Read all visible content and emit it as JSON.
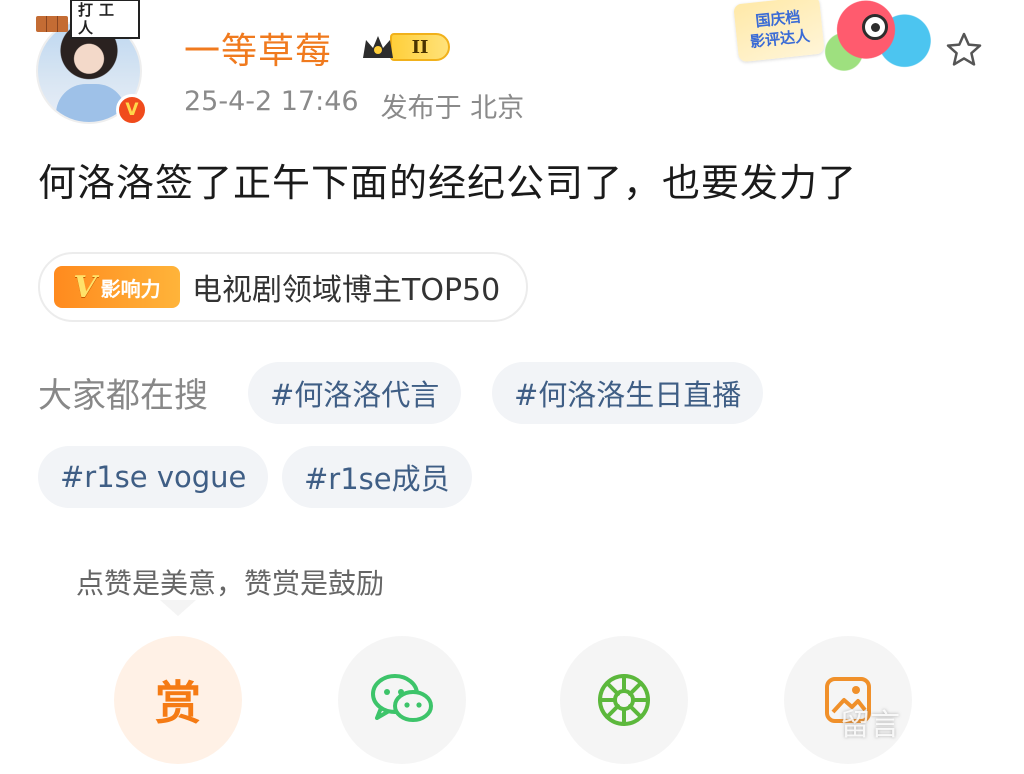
{
  "header": {
    "frame_badge_text": "打工人",
    "username": "一等草莓",
    "verified_symbol": "V",
    "vip_level": "II",
    "timestamp": "25-4-2 17:46",
    "publish_location": "发布于 北京",
    "event_sticker": {
      "line1": "国庆档",
      "line2": "影评达人"
    }
  },
  "post": {
    "text": "何洛洛签了正午下面的经纪公司了，也要发力了"
  },
  "influence": {
    "tag_symbol": "V",
    "tag_label": "影响力",
    "text": "电视剧领域博主TOP50"
  },
  "trending": {
    "label": "大家都在搜",
    "chips": [
      "#何洛洛代言",
      "#何洛洛生日直播",
      "#r1se vogue",
      "#r1se成员"
    ]
  },
  "actions": {
    "hint": "点赞是美意，赞赏是鼓励",
    "tip_label": "赏",
    "icons": [
      "tip-icon",
      "wechat-icon",
      "moments-icon",
      "save-image-icon"
    ]
  },
  "watermark": "留言",
  "colors": {
    "username": "#f07a1e",
    "chip_text": "#3f5e85",
    "tip_orange": "#f57b14",
    "wechat_green": "#3dc46a"
  }
}
